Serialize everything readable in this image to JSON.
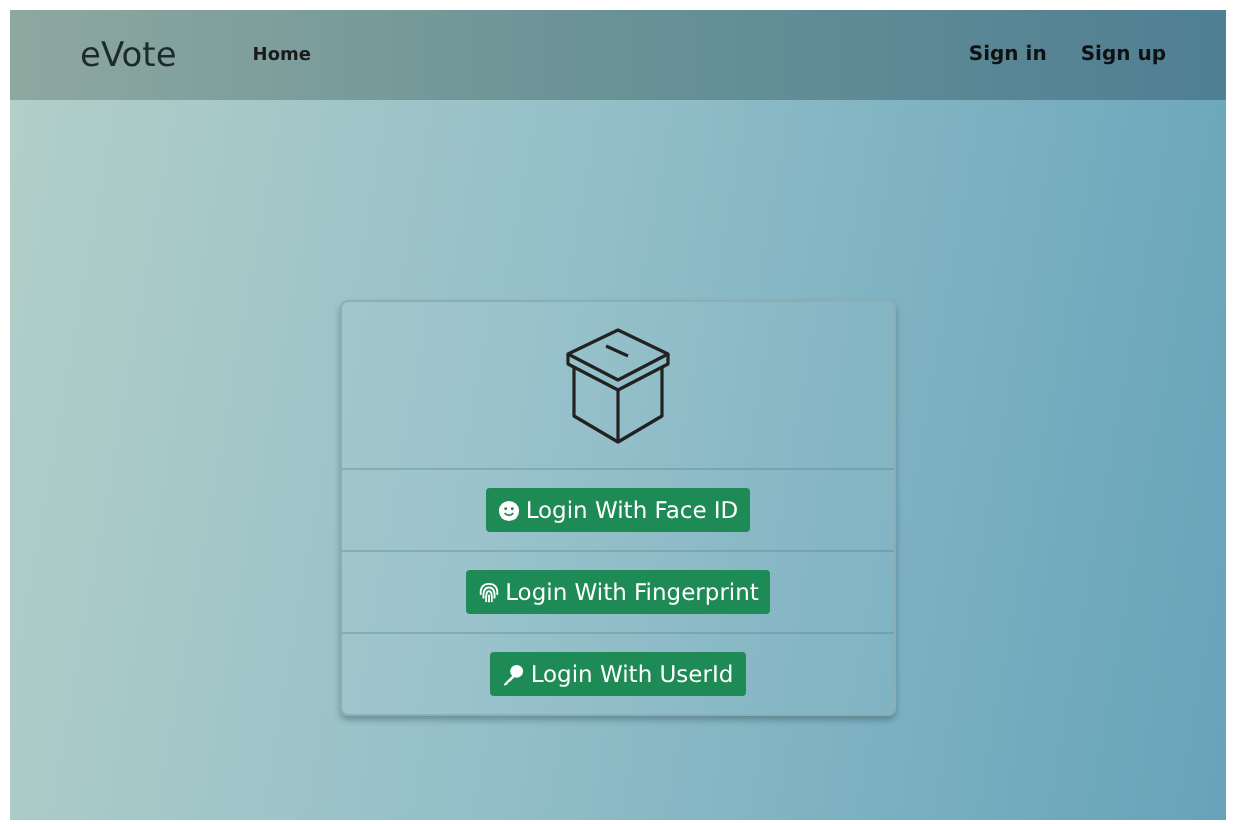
{
  "navbar": {
    "brand": "eVote",
    "links": [
      "Home"
    ],
    "auth_links": [
      "Sign in",
      "Sign up"
    ]
  },
  "login_options": [
    {
      "kind": "face",
      "label": "Login With Face ID"
    },
    {
      "kind": "fingerprint",
      "label": "Login With Fingerprint"
    },
    {
      "kind": "key",
      "label": "Login With UserId"
    }
  ]
}
